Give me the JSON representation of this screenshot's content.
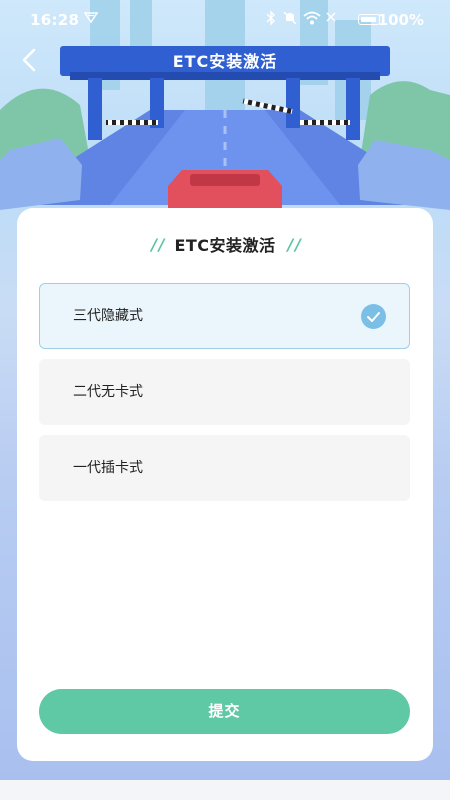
{
  "status_bar": {
    "time": "16:28",
    "battery": "100%",
    "icons": [
      "vpn-icon",
      "bluetooth-icon",
      "mute-icon",
      "wifi-icon",
      "no-signal-icon",
      "battery-icon"
    ]
  },
  "nav": {
    "back_icon": "chevron-left-icon",
    "title": "ETC安装激活"
  },
  "card": {
    "title": "ETC安装激活",
    "options": [
      {
        "label": "三代隐藏式",
        "selected": true
      },
      {
        "label": "二代无卡式",
        "selected": false
      },
      {
        "label": "一代插卡式",
        "selected": false
      }
    ],
    "submit_label": "提交"
  },
  "colors": {
    "accent_green": "#5ec9a4",
    "selected_border": "#9fcfe7",
    "selected_bg": "#eaf6fb",
    "check_blue": "#7bbfe6",
    "toll_blue": "#3b6fe0"
  }
}
